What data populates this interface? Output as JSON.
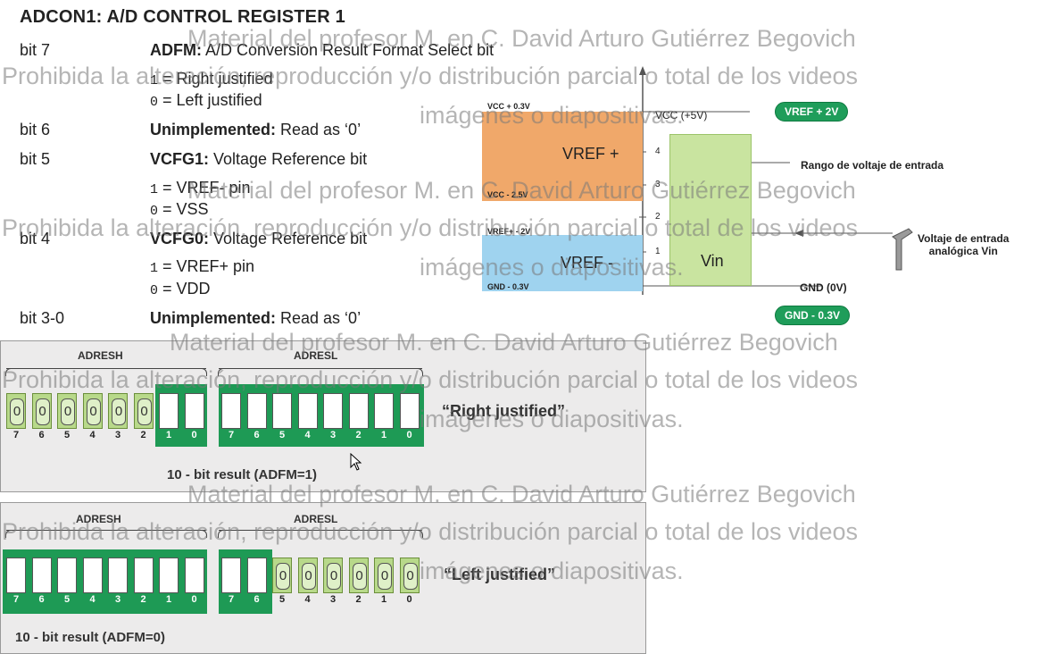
{
  "register": {
    "title": "ADCON1: A/D CONTROL REGISTER 1",
    "rows": [
      {
        "bit": "bit 7",
        "name": "ADFM:",
        "desc": " A/D Conversion Result Format Select bit"
      },
      {
        "opt1": "1",
        "opt1_text": " = Right justified",
        "opt0": "0",
        "opt0_text": " = Left justified"
      },
      {
        "bit": "bit 6",
        "name": "Unimplemented:",
        "desc": " Read as ‘0’"
      },
      {
        "bit": "bit 5",
        "name": "VCFG1:",
        "desc": " Voltage Reference bit"
      },
      {
        "opt1": "1",
        "opt1_text": " = VREF- pin",
        "opt0": "0",
        "opt0_text": " = VSS"
      },
      {
        "bit": "bit 4",
        "name": "VCFG0:",
        "desc": " Voltage Reference bit"
      },
      {
        "opt1": "1",
        "opt1_text": " = VREF+ pin",
        "opt0": "0",
        "opt0_text": " = VDD"
      },
      {
        "bit": "bit 3-0",
        "name": "Unimplemented:",
        "desc": " Read as ‘0’"
      }
    ]
  },
  "diagram": {
    "vcc_plus": "VCC + 0.3V",
    "vcc": "VCC (+5V)",
    "vcc_minus": "VCC - 2.5V",
    "vref_plus_2v": "VREF+ - 2V",
    "gnd_minus": "GND - 0.3V",
    "gnd": "GND (0V)",
    "vref_plus_box": "VREF +",
    "vref_minus_box": "VREF -",
    "vin": "Vin",
    "ticks": [
      "4",
      "3",
      "2",
      "1"
    ],
    "pill_top": "VREF + 2V",
    "pill_bottom": "GND - 0.3V",
    "range_label": "Rango de voltaje de entrada",
    "analog_label_1": "Voltaje de entrada",
    "analog_label_2": "analógica Vin",
    "colors": {
      "orange": "#f0a86a",
      "blue": "#9fd3ef",
      "green": "#c9e4a0",
      "pill": "#1f9d5a"
    }
  },
  "right_panel": {
    "adresh": "ADRESH",
    "adresl": "ADRESL",
    "justify": "“Right justified”",
    "result": "10 - bit result (ADFM=1)",
    "numbers": [
      "7",
      "6",
      "5",
      "4",
      "3",
      "2",
      "1",
      "0",
      "7",
      "6",
      "5",
      "4",
      "3",
      "2",
      "1",
      "0"
    ]
  },
  "left_panel": {
    "adresh": "ADRESH",
    "adresl": "ADRESL",
    "justify": "“Left justified”",
    "result": "10 - bit result (ADFM=0)",
    "numbers": [
      "7",
      "6",
      "5",
      "4",
      "3",
      "2",
      "1",
      "0",
      "7",
      "6",
      "5",
      "4",
      "3",
      "2",
      "1",
      "0"
    ]
  },
  "zero": "0",
  "watermark": {
    "line1": "Material del profesor M. en C. David Arturo Gutiérrez Begovich",
    "line2": "Prohibida la alteración, reproducción y/o distribución parcial o total de los videos",
    "line3": "imágenes o diapositivas."
  }
}
